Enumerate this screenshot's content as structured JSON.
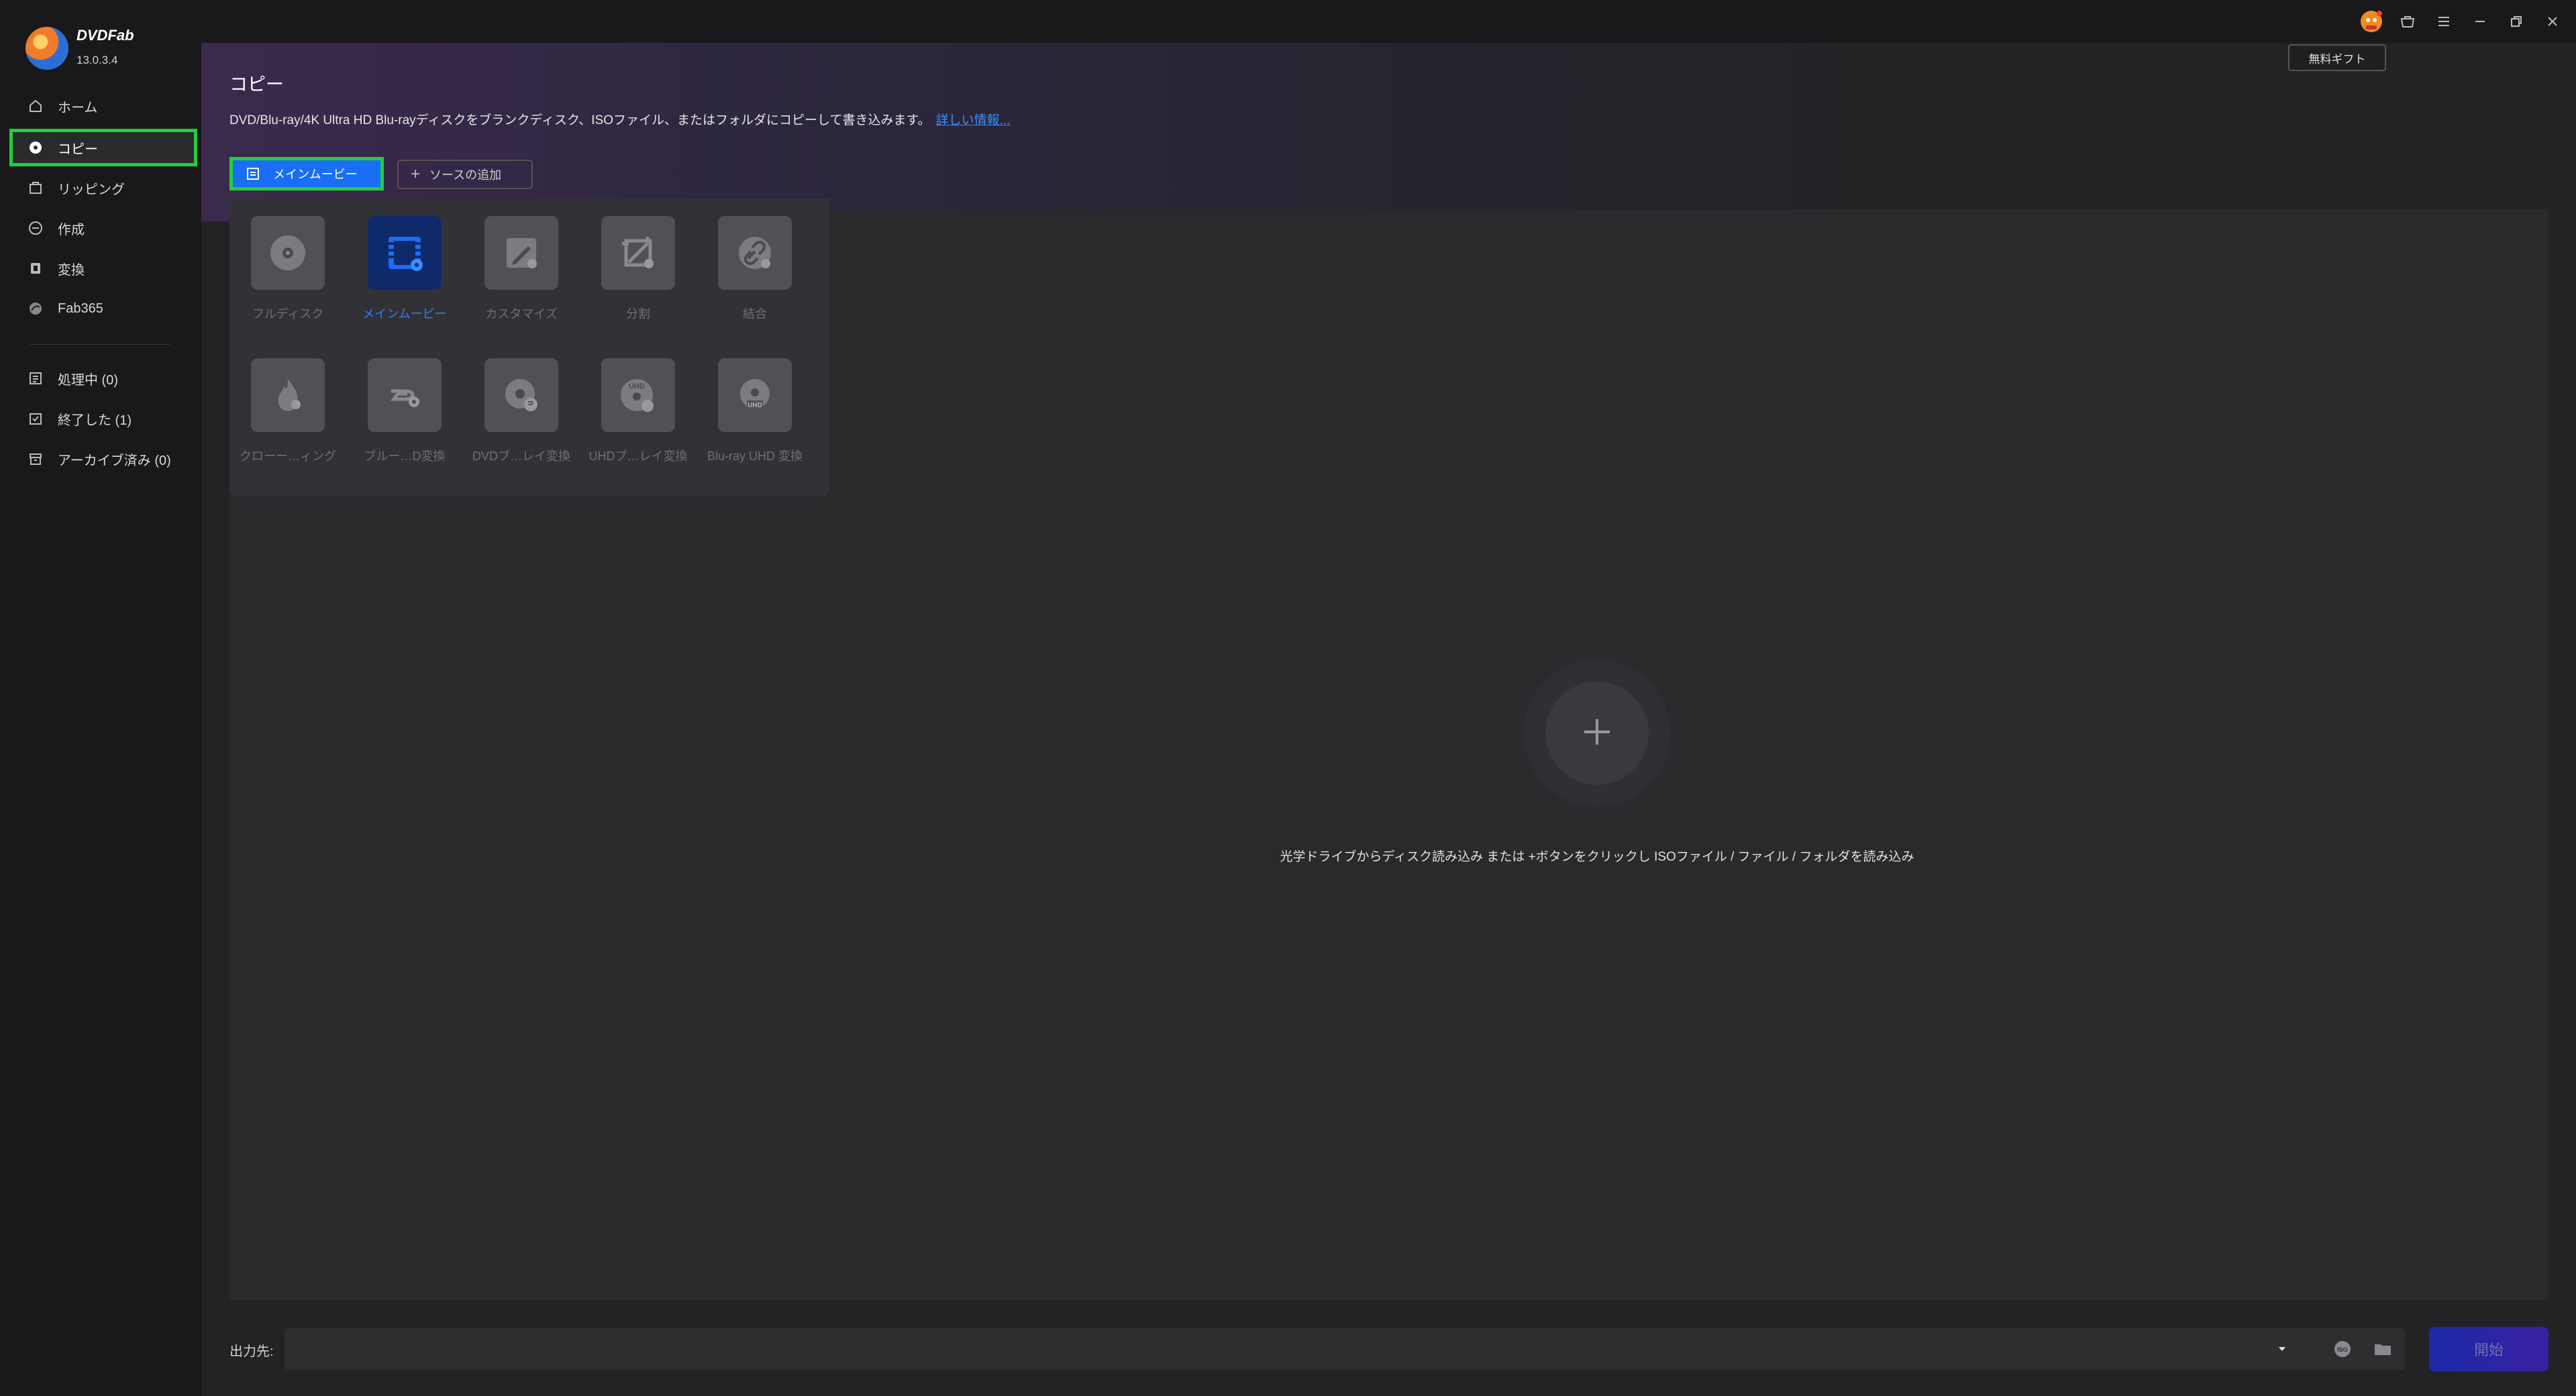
{
  "app": {
    "brand": "DVDFab",
    "version": "13.0.3.4"
  },
  "sidebar": {
    "items": [
      {
        "label": "ホーム",
        "icon": "home-icon"
      },
      {
        "label": "コピー",
        "icon": "copy-disc-icon"
      },
      {
        "label": "リッピング",
        "icon": "ripper-icon"
      },
      {
        "label": "作成",
        "icon": "creator-icon"
      },
      {
        "label": "変換",
        "icon": "converter-icon"
      },
      {
        "label": "Fab365",
        "icon": "fab365-icon"
      }
    ],
    "queue": [
      {
        "label": "処理中 (0)",
        "icon": "processing-icon"
      },
      {
        "label": "終了した (1)",
        "icon": "finished-icon"
      },
      {
        "label": "アーカイブ済み (0)",
        "icon": "archive-icon"
      }
    ]
  },
  "header": {
    "title": "コピー",
    "description": "DVD/Blu-ray/4K Ultra HD Blu-rayディスクをブランクディスク、ISOファイル、またはフォルダにコピーして書き込みます。",
    "more_link": "詳しい情報..."
  },
  "toolbar": {
    "mode_label": "メインムービー",
    "add_source_label": "ソースの追加"
  },
  "modes": [
    {
      "label": "フルディスク",
      "icon": "full-disc-icon"
    },
    {
      "label": "メインムービー",
      "icon": "main-movie-icon",
      "selected": true
    },
    {
      "label": "カスタマイズ",
      "icon": "customize-icon"
    },
    {
      "label": "分割",
      "icon": "split-icon"
    },
    {
      "label": "結合",
      "icon": "merge-icon"
    },
    {
      "label": "クローー…ィング",
      "icon": "clone-burn-icon"
    },
    {
      "label": "ブルー…D変換",
      "icon": "bluray-to-dvd-icon"
    },
    {
      "label": "DVDブ…レイ変換",
      "icon": "dvd-to-bluray-icon"
    },
    {
      "label": "UHDブ…レイ変換",
      "icon": "uhd-to-bluray-icon"
    },
    {
      "label": "Blu-ray UHD 変換",
      "icon": "bluray-to-uhd-icon"
    }
  ],
  "drop_hint": "光学ドライブからディスク読み込み または +ボタンをクリックし ISOファイル / ファイル / フォルダを読み込み",
  "output": {
    "label": "出力先:",
    "value": ""
  },
  "start_label": "開始",
  "gift_label": "無料ギフト",
  "colors": {
    "accent": "#1a6ef5",
    "highlight": "#21d03a",
    "link": "#3a8dff"
  }
}
